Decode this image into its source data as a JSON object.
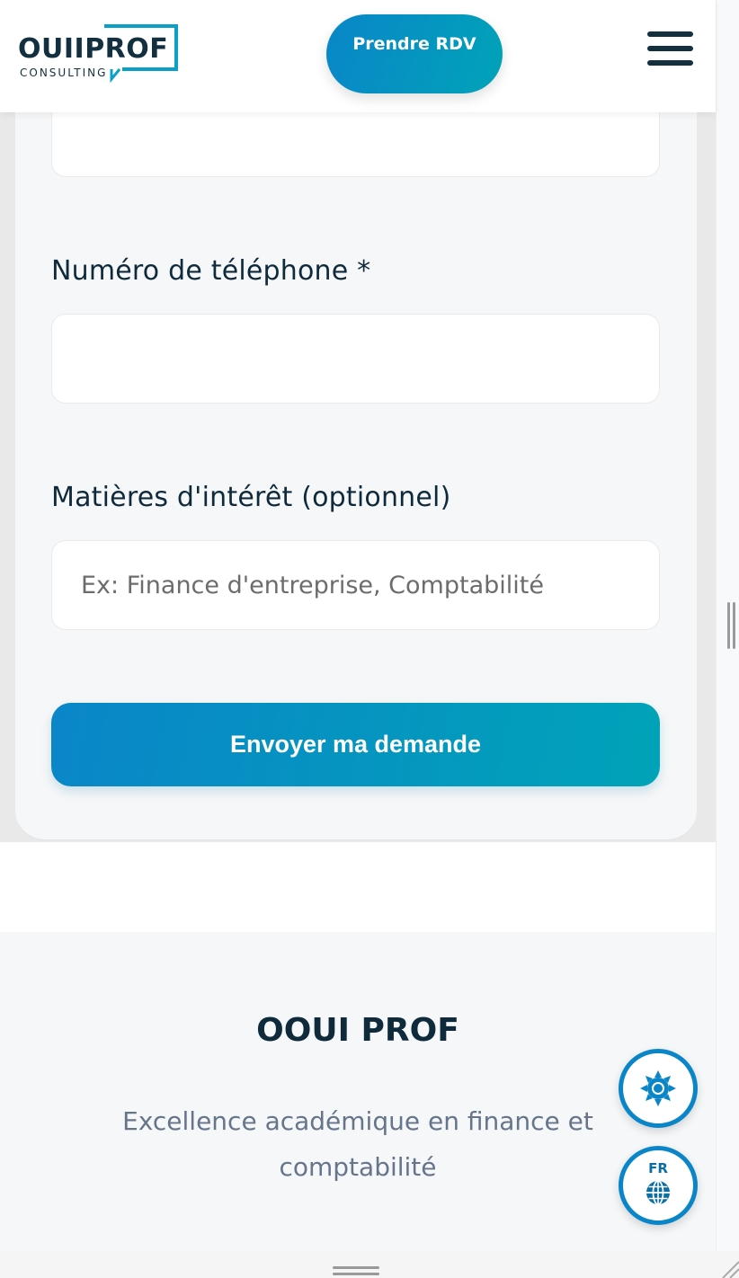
{
  "header": {
    "logo_main": "OUIIPROF",
    "logo_sub": "CONSULTING",
    "cta_label": "Prendre RDV",
    "menu_icon": "hamburger-menu-icon"
  },
  "form": {
    "phone_label": "Numéro de téléphone *",
    "phone_value": "",
    "interests_label": "Matières d'intérêt (optionnel)",
    "interests_placeholder": "Ex: Finance d'entreprise, Comptabilité",
    "submit_label": "Envoyer ma demande"
  },
  "footer": {
    "title": "OOUI PROF",
    "tagline": "Excellence académique en finance et comptabilité"
  },
  "floating": {
    "theme_icon": "sun-icon",
    "language_code": "FR",
    "language_icon": "globe-icon"
  },
  "colors": {
    "brand_gradient_start": "#0a86c8",
    "brand_gradient_end": "#00a3b8",
    "brand_dark": "#12303f",
    "text_muted": "#66758a"
  }
}
